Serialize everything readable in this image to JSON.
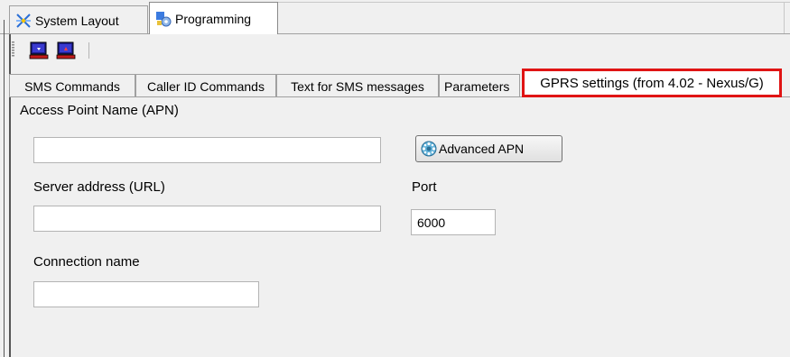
{
  "outer_tabs": [
    {
      "label": "System Layout",
      "icon": "system-layout-icon",
      "active": false
    },
    {
      "label": "Programming",
      "icon": "programming-icon",
      "active": true
    }
  ],
  "toolbar": [
    {
      "icon": "read-from-device-icon"
    },
    {
      "icon": "write-to-device-icon"
    }
  ],
  "inner_tabs": [
    {
      "label": "SMS Commands"
    },
    {
      "label": "Caller ID Commands"
    },
    {
      "label": "Text for SMS messages"
    },
    {
      "label": "Parameters"
    },
    {
      "label": "GPRS settings (from 4.02 - Nexus/G)",
      "active": true,
      "highlight": "#e01414"
    }
  ],
  "form": {
    "apn_label": "Access Point Name (APN)",
    "apn_value": "",
    "advanced_apn_label": "Advanced APN",
    "server_label": "Server address (URL)",
    "server_value": "",
    "port_label": "Port",
    "port_value": "6000",
    "connection_label": "Connection name",
    "connection_value": ""
  }
}
